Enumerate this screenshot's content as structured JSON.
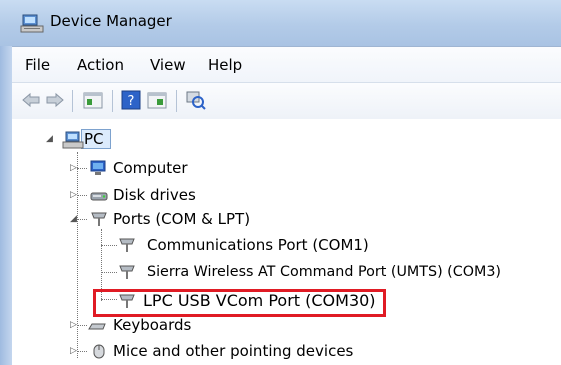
{
  "window": {
    "title": "Device Manager"
  },
  "menu": [
    "File",
    "Action",
    "View",
    "Help"
  ],
  "tree": {
    "root": "PC",
    "items": {
      "computer": "Computer",
      "disk_drives": "Disk drives",
      "ports": "Ports (COM & LPT)",
      "comm_port": "Communications Port (COM1)",
      "sierra_port": "Sierra Wireless AT Command Port (UMTS) (COM3)",
      "lpc_port": "LPC USB VCom Port (COM30)",
      "keyboards": "Keyboards",
      "mice": "Mice and other pointing devices"
    }
  },
  "icons": [
    "device-manager-icon",
    "back-icon",
    "forward-icon",
    "properties-icon",
    "help-icon",
    "details-icon",
    "scan-hardware-icon",
    "computer-icon",
    "disk-icon",
    "port-icon",
    "keyboard-icon",
    "mouse-icon"
  ],
  "colors": {
    "highlight": "#e01b24",
    "titlebar": "#b3cbe8"
  }
}
